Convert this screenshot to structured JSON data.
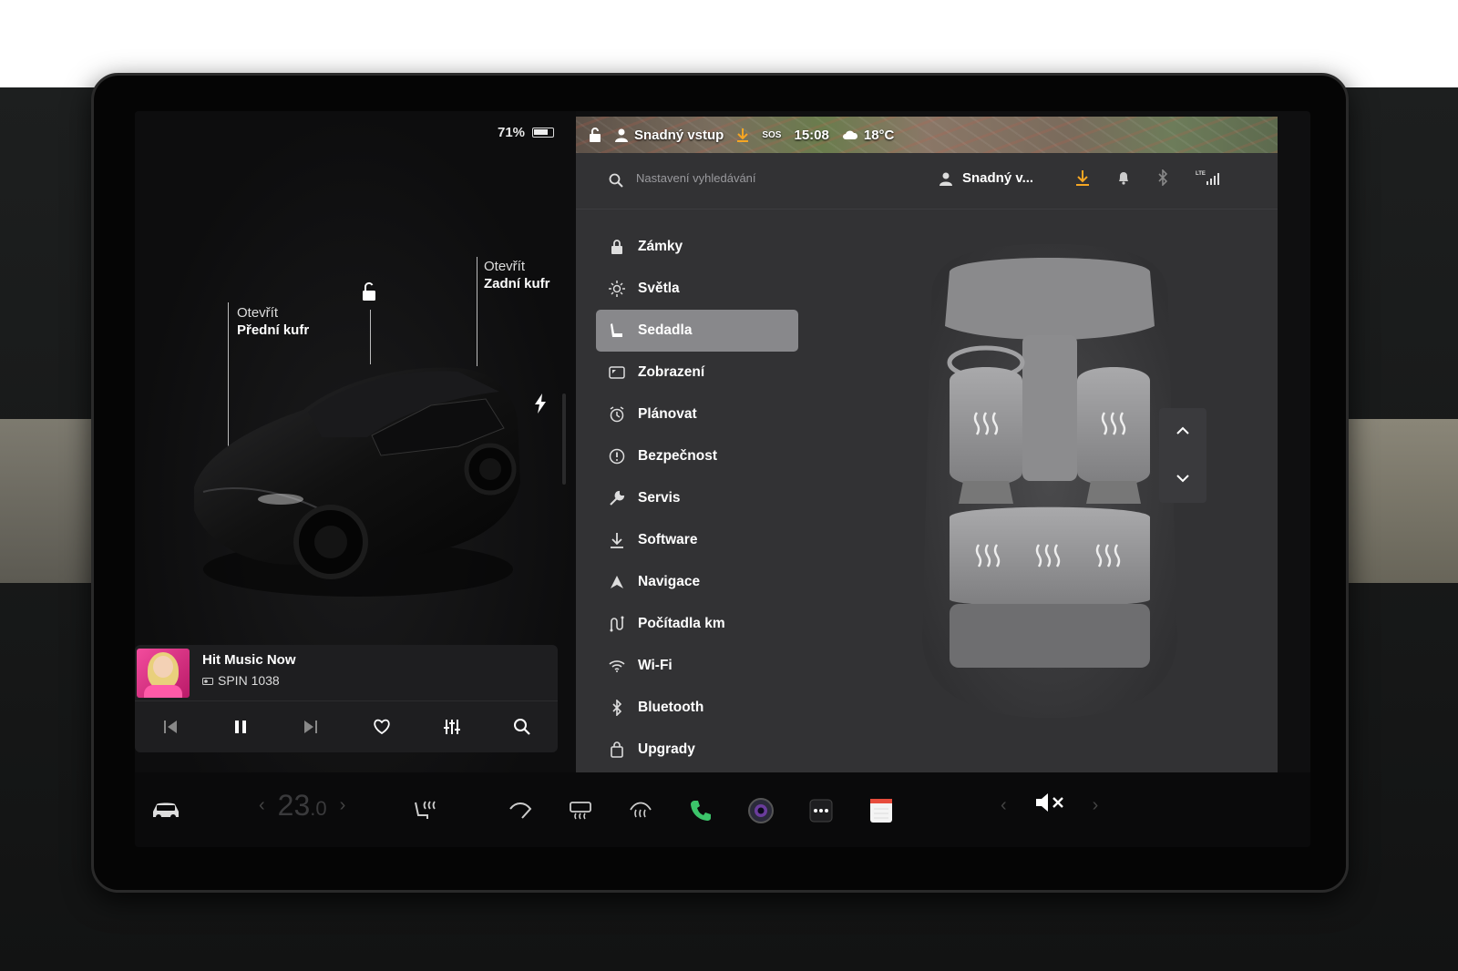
{
  "battery": {
    "percent_label": "71%",
    "level": 0.71
  },
  "car": {
    "front_trunk": {
      "line1": "Otevřít",
      "line2": "Přední kufr"
    },
    "rear_trunk": {
      "line1": "Otevřít",
      "line2": "Zadní kufr"
    }
  },
  "music": {
    "title": "Hit Music Now",
    "station": "SPIN 1038"
  },
  "status": {
    "profile": "Snadný vstup",
    "sos": "SOS",
    "time": "15:08",
    "temperature": "18°C"
  },
  "settings": {
    "search_placeholder": "Nastavení vyhledávání",
    "profile_short": "Snadný v...",
    "menu": [
      {
        "label": "Zámky",
        "icon": "lock-icon"
      },
      {
        "label": "Světla",
        "icon": "light-icon"
      },
      {
        "label": "Sedadla",
        "icon": "seat-icon",
        "active": true
      },
      {
        "label": "Zobrazení",
        "icon": "display-icon"
      },
      {
        "label": "Plánovat",
        "icon": "alarm-clock-icon"
      },
      {
        "label": "Bezpečnost",
        "icon": "info-circle-icon"
      },
      {
        "label": "Servis",
        "icon": "wrench-icon"
      },
      {
        "label": "Software",
        "icon": "download-icon"
      },
      {
        "label": "Navigace",
        "icon": "navigation-arrow-icon"
      },
      {
        "label": "Počítadla km",
        "icon": "trip-icon"
      },
      {
        "label": "Wi-Fi",
        "icon": "wifi-icon"
      },
      {
        "label": "Bluetooth",
        "icon": "bluetooth-icon"
      },
      {
        "label": "Upgrady",
        "icon": "bag-icon"
      }
    ]
  },
  "dock": {
    "temp_whole": "23",
    "temp_decimal": ".0"
  },
  "colors": {
    "accent_orange": "#f5a623",
    "active_menu": "#88888b",
    "phone_green": "#3cc46a"
  }
}
